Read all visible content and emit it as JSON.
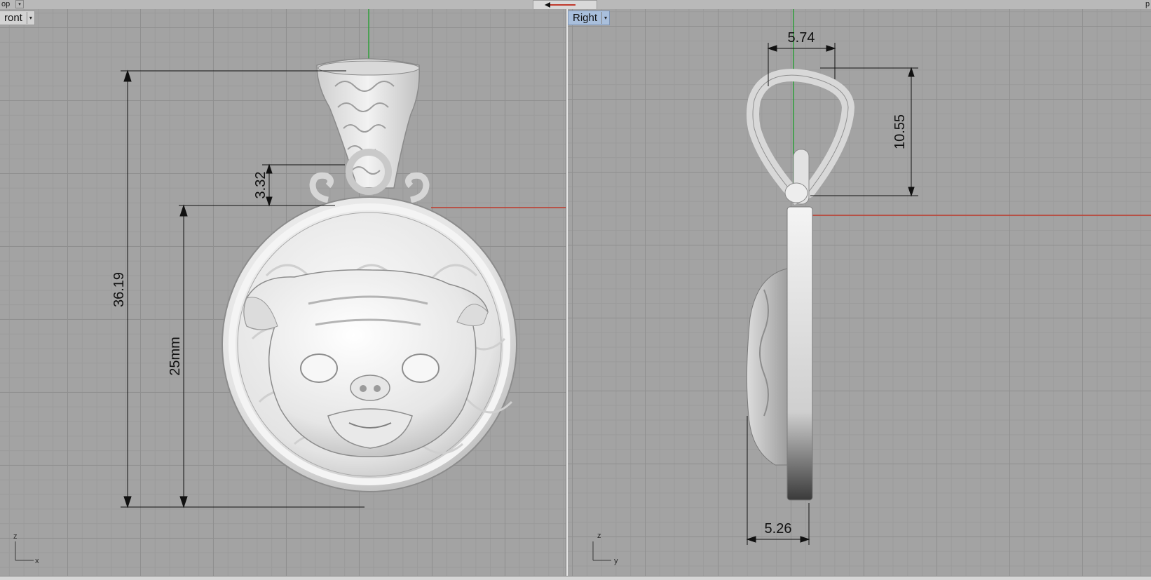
{
  "top_bar": {
    "left_label": "op",
    "right_label": "p"
  },
  "front_view": {
    "label": "ront",
    "dims": {
      "total_height": "36.19",
      "disc_diameter": "25mm",
      "bail_gap": "3.32"
    },
    "axes": {
      "vertical": "z",
      "horizontal": "x"
    }
  },
  "right_view": {
    "label": "Right",
    "dims": {
      "bail_width": "5.74",
      "bail_height": "10.55",
      "depth": "5.26"
    },
    "axes": {
      "vertical": "z",
      "horizontal": "y"
    }
  },
  "colors": {
    "x_axis": "#c0392b",
    "y_axis": "#2e9e3a",
    "selected_tab": "#a9bfdc"
  }
}
